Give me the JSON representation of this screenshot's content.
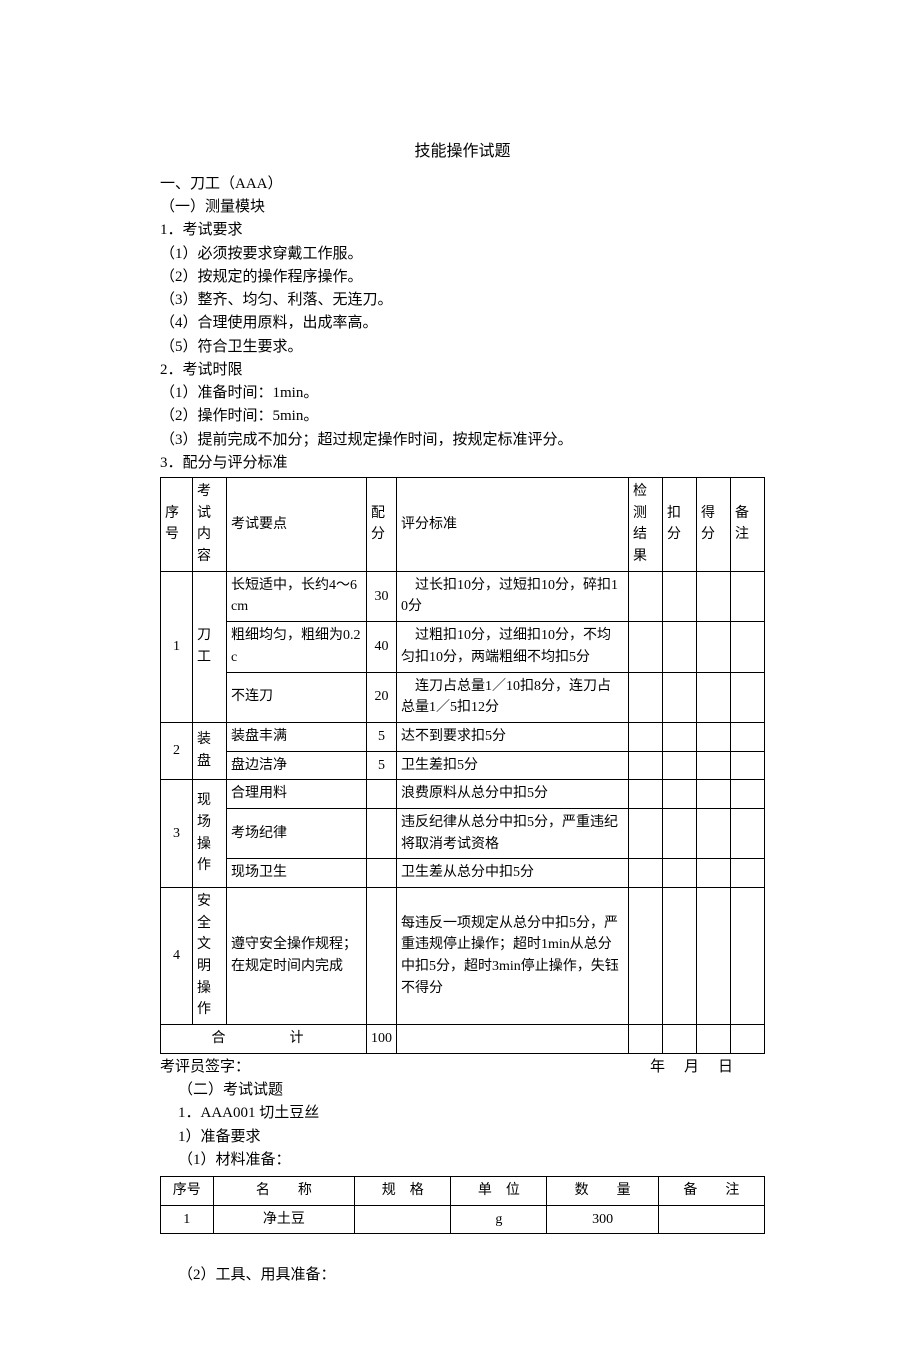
{
  "title": "技能操作试题",
  "section1": {
    "heading": "一、刀工（AAA）",
    "sub1": "（一）测量模块",
    "req_heading": "1．考试要求",
    "reqs": [
      "（1）必须按要求穿戴工作服。",
      "（2）按规定的操作程序操作。",
      "（3）整齐、均匀、利落、无连刀。",
      "（4）合理使用原料，出成率高。",
      "（5）符合卫生要求。"
    ],
    "time_heading": "2．考试时限",
    "times": [
      "（1）准备时间：1min。",
      "（2）操作时间：5min。",
      "（3）提前完成不加分；超过规定操作时间，按规定标准评分。"
    ],
    "scoring_heading": "3．配分与评分标准"
  },
  "scoring_table": {
    "headers": {
      "seq": "序号",
      "content": "考试内容",
      "points": "考试要点",
      "score": "配分",
      "criteria": "评分标准",
      "check": "检测结果",
      "deduct": "扣分",
      "got": "得分",
      "remark": "备注"
    },
    "rows": [
      {
        "seq": "1",
        "content": "刀工",
        "items": [
          {
            "point": "长短适中，长约4～6cm",
            "score": "30",
            "criteria": "　过长扣10分，过短扣10分，碎扣10分"
          },
          {
            "point": "粗细均匀，粗细为0.2 c",
            "score": "40",
            "criteria": "　过粗扣10分，过细扣10分，不均匀扣10分，两端粗细不均扣5分"
          },
          {
            "point": "不连刀",
            "score": "20",
            "criteria": "　连刀占总量1／10扣8分，连刀占总量1／5扣12分"
          }
        ]
      },
      {
        "seq": "2",
        "content": "装盘",
        "items": [
          {
            "point": "装盘丰满",
            "score": "5",
            "criteria": "达不到要求扣5分"
          },
          {
            "point": "盘边洁净",
            "score": "5",
            "criteria": "卫生差扣5分"
          }
        ]
      },
      {
        "seq": "3",
        "content": "现场操作",
        "items": [
          {
            "point": "合理用料",
            "score": "",
            "criteria": "浪费原料从总分中扣5分"
          },
          {
            "point": "考场纪律",
            "score": "",
            "criteria": "违反纪律从总分中扣5分，严重违纪将取消考试资格"
          },
          {
            "point": "现场卫生",
            "score": "",
            "criteria": "卫生差从总分中扣5分"
          }
        ]
      },
      {
        "seq": "4",
        "content": "安全文明操作",
        "items": [
          {
            "point": "遵守安全操作规程；在规定时间内完成",
            "score": "",
            "criteria": "每违反一项规定从总分中扣5分，严重违规停止操作；超时1min从总分中扣5分，超时3min停止操作，失钰不得分"
          }
        ]
      }
    ],
    "total_label": "合　　计",
    "total_score": "100"
  },
  "signature": {
    "left": "考评员签字：",
    "right": "年　月　日"
  },
  "section2": {
    "heading": "（二）考试试题",
    "item": "1．AAA001 切土豆丝",
    "prep": "1）准备要求",
    "materials_label": "（1）材料准备："
  },
  "materials_table": {
    "headers": {
      "seq": "序号",
      "name": "名　　称",
      "spec": "规　格",
      "unit": "单　位",
      "qty": "数　　量",
      "remark": "备　　注"
    },
    "rows": [
      {
        "seq": "1",
        "name": "净土豆",
        "spec": "",
        "unit": "g",
        "qty": "300",
        "remark": ""
      }
    ]
  },
  "tools_label": "（2）工具、用具准备："
}
